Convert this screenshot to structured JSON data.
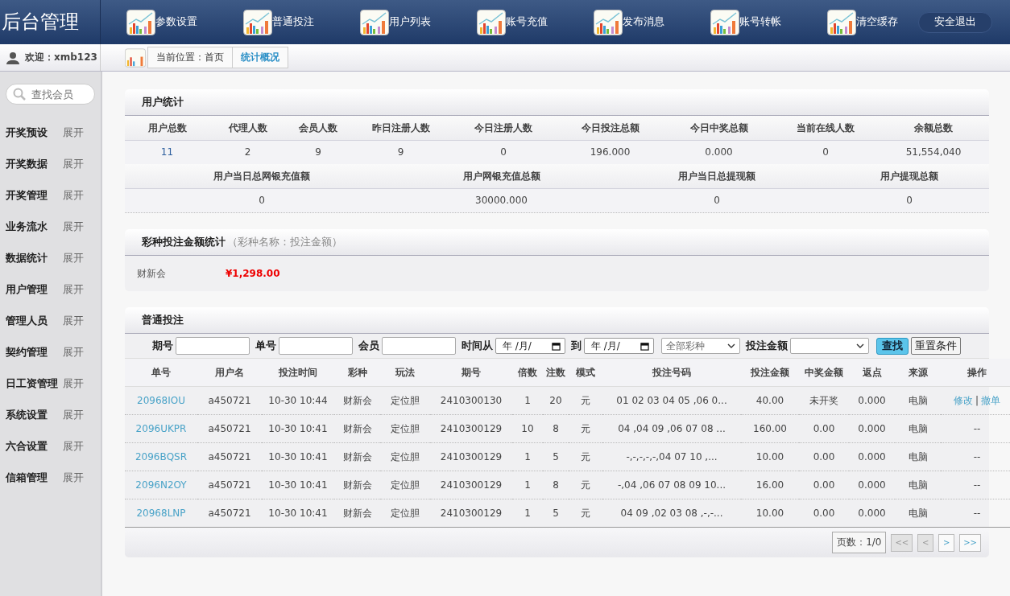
{
  "brand": "后台管理",
  "nav": [
    "参数设置",
    "普通投注",
    "用户列表",
    "账号充值",
    "发布消息",
    "账号转帐",
    "清空缓存"
  ],
  "logout": "安全退出",
  "welcome": "欢迎：xmb123",
  "breadcrumb": [
    "当前位置：首页",
    "统计概况"
  ],
  "search": {
    "placeholder": "查找会员"
  },
  "sidebar": {
    "items": [
      {
        "label": "开奖预设",
        "action": "展开"
      },
      {
        "label": "开奖数据",
        "action": "展开"
      },
      {
        "label": "开奖管理",
        "action": "展开"
      },
      {
        "label": "业务流水",
        "action": "展开"
      },
      {
        "label": "数据统计",
        "action": "展开"
      },
      {
        "label": "用户管理",
        "action": "展开"
      },
      {
        "label": "管理人员",
        "action": "展开"
      },
      {
        "label": "契约管理",
        "action": "展开"
      },
      {
        "label": "日工资管理",
        "action": "展开"
      },
      {
        "label": "系统设置",
        "action": "展开"
      },
      {
        "label": "六合设置",
        "action": "展开"
      },
      {
        "label": "信箱管理",
        "action": "展开"
      }
    ]
  },
  "user_stats": {
    "title": "用户统计",
    "row1": {
      "headers": [
        "用户总数",
        "代理人数",
        "会员人数",
        "昨日注册人数",
        "今日注册人数",
        "今日投注总额",
        "今日中奖总额",
        "当前在线人数",
        "余额总数"
      ],
      "values": [
        "11",
        "2",
        "9",
        "9",
        "0",
        "196.000",
        "0.000",
        "0",
        "51,554,040"
      ]
    },
    "row2": {
      "headers": [
        "用户当日总网银充值额",
        "用户网银充值总额",
        "用户当日总提现额",
        "用户提现总额"
      ],
      "values": [
        "0",
        "30000.000",
        "0",
        "0"
      ]
    }
  },
  "lottery_stats": {
    "title": "彩种投注金额统计",
    "subtitle": "（彩种名称：投注金额）",
    "items": [
      {
        "name": "财新会",
        "amount": "¥1,298.00"
      }
    ]
  },
  "bets": {
    "title": "普通投注",
    "filters": [
      {
        "kind": "text",
        "label": "期号"
      },
      {
        "kind": "text",
        "label": "单号"
      },
      {
        "kind": "text",
        "label": "会员"
      },
      {
        "kind": "date",
        "label": "时间从",
        "value": "年 /月/"
      },
      {
        "kind": "date",
        "label": "到",
        "value": "年 /月/"
      },
      {
        "kind": "select",
        "value": "全部彩种"
      },
      {
        "kind": "select",
        "label": "投注金额"
      }
    ],
    "search_button": "查找",
    "reset_button": "重置条件",
    "columns": [
      "单号",
      "用户名",
      "投注时间",
      "彩种",
      "玩法",
      "期号",
      "倍数",
      "注数",
      "模式",
      "投注号码",
      "投注金额",
      "中奖金额",
      "返点",
      "来源",
      "操作"
    ],
    "rows": [
      {
        "cells": [
          "20968IOU",
          "a450721",
          "10-30 10:44",
          "财新会",
          "定位胆",
          "2410300130",
          "1",
          "20",
          "元",
          "01 02 03 04 05 ,06 0...",
          "40.00",
          "未开奖",
          "0.000",
          "电脑"
        ],
        "actions": [
          "修改",
          "撤单"
        ],
        "action_separator": "|"
      },
      {
        "cells": [
          "2096UKPR",
          "a450721",
          "10-30 10:41",
          "财新会",
          "定位胆",
          "2410300129",
          "10",
          "8",
          "元",
          "04 ,04 09 ,06 07 08 ...",
          "160.00",
          "0.00",
          "0.000",
          "电脑"
        ],
        "placeholder_action": "--"
      },
      {
        "cells": [
          "2096BQSR",
          "a450721",
          "10-30 10:41",
          "财新会",
          "定位胆",
          "2410300129",
          "1",
          "5",
          "元",
          "-,-,-,-,-,04 07 10 ,...",
          "10.00",
          "0.00",
          "0.000",
          "电脑"
        ],
        "placeholder_action": "--"
      },
      {
        "cells": [
          "2096N2OY",
          "a450721",
          "10-30 10:41",
          "财新会",
          "定位胆",
          "2410300129",
          "1",
          "8",
          "元",
          "-,04 ,06 07 08 09 10...",
          "16.00",
          "0.00",
          "0.000",
          "电脑"
        ],
        "placeholder_action": "--"
      },
      {
        "cells": [
          "20968LNP",
          "a450721",
          "10-30 10:41",
          "财新会",
          "定位胆",
          "2410300129",
          "1",
          "5",
          "元",
          "04 09 ,02 03 08 ,-,-...",
          "10.00",
          "0.00",
          "0.000",
          "电脑"
        ],
        "placeholder_action": "--"
      }
    ],
    "pager": {
      "info": "页数：1/0",
      "buttons": [
        "<<",
        "<",
        ">",
        ">>"
      ]
    }
  }
}
